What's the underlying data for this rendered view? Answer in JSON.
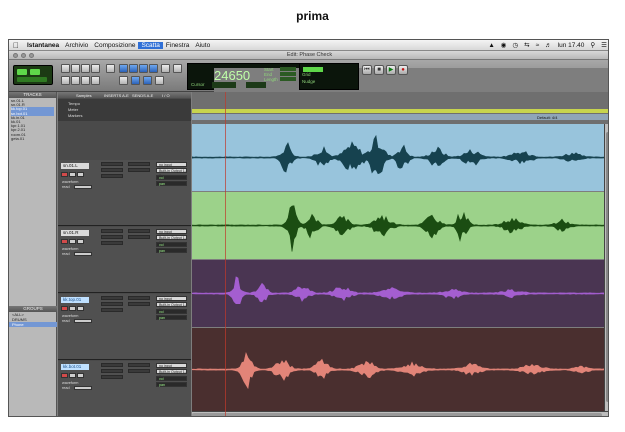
{
  "caption": "prima",
  "menubar": {
    "app": "Istantanea",
    "items": [
      "Archivio",
      "Composizione",
      "Scatta",
      "Finestra",
      "Aiuto"
    ],
    "active": "Scatta",
    "clock": "lun 17.40"
  },
  "window": {
    "title": "Edit: Phase Check"
  },
  "counter": {
    "value": "24650",
    "start_label": "Start",
    "end_label": "End",
    "length_label": "Length",
    "cursor_label": "Cursor",
    "grid_label": "Grid",
    "nudge_label": "Nudge"
  },
  "panels": {
    "tracks_header": "TRACKS",
    "groups_header": "GROUPS",
    "samples_label": "Samples",
    "tempo_label": "Tempo",
    "meter_label": "Meter",
    "markers_label": "Markers",
    "inserts_header": "INSERTS A-E",
    "sends_header": "SENDS A-E",
    "io_header": "I / O",
    "default_marker": "Default: 4/4"
  },
  "tracks_list": [
    "sn.01.L",
    "sn.01.R",
    "kk.top.01",
    "sn.bot.01",
    "kk.in.01",
    "kk.01",
    "kpr.1.01",
    "kpr.2.01",
    "room.01",
    "geta.01"
  ],
  "groups_list": [
    "<ALL>",
    "DRUMS",
    "Phone"
  ],
  "tracks": [
    {
      "name": "sn.01.L",
      "volume": "vol",
      "pan": "pan"
    },
    {
      "name": "sn.01.R",
      "volume": "vol",
      "pan": "pan"
    },
    {
      "name": "kk.top.01",
      "volume": "vol",
      "pan": "pan"
    },
    {
      "name": "kk.bot.01",
      "volume": "vol",
      "pan": "pan"
    }
  ],
  "track_controls": {
    "waveform_label": "waveform",
    "dyn_label": "dyn",
    "read_label": "read",
    "no_input": "no input",
    "output": "Built-in Output 1-2"
  },
  "colors": {
    "lane1": "#98c4dc",
    "lane2": "#9cd28a",
    "lane3": "#4a3552",
    "lane4": "#4a2f2f",
    "wave1": "#16424f",
    "wave2": "#1b4d12",
    "wave3": "#a45ed0",
    "wave4": "#e28478",
    "accent": "#2f6fd6"
  }
}
